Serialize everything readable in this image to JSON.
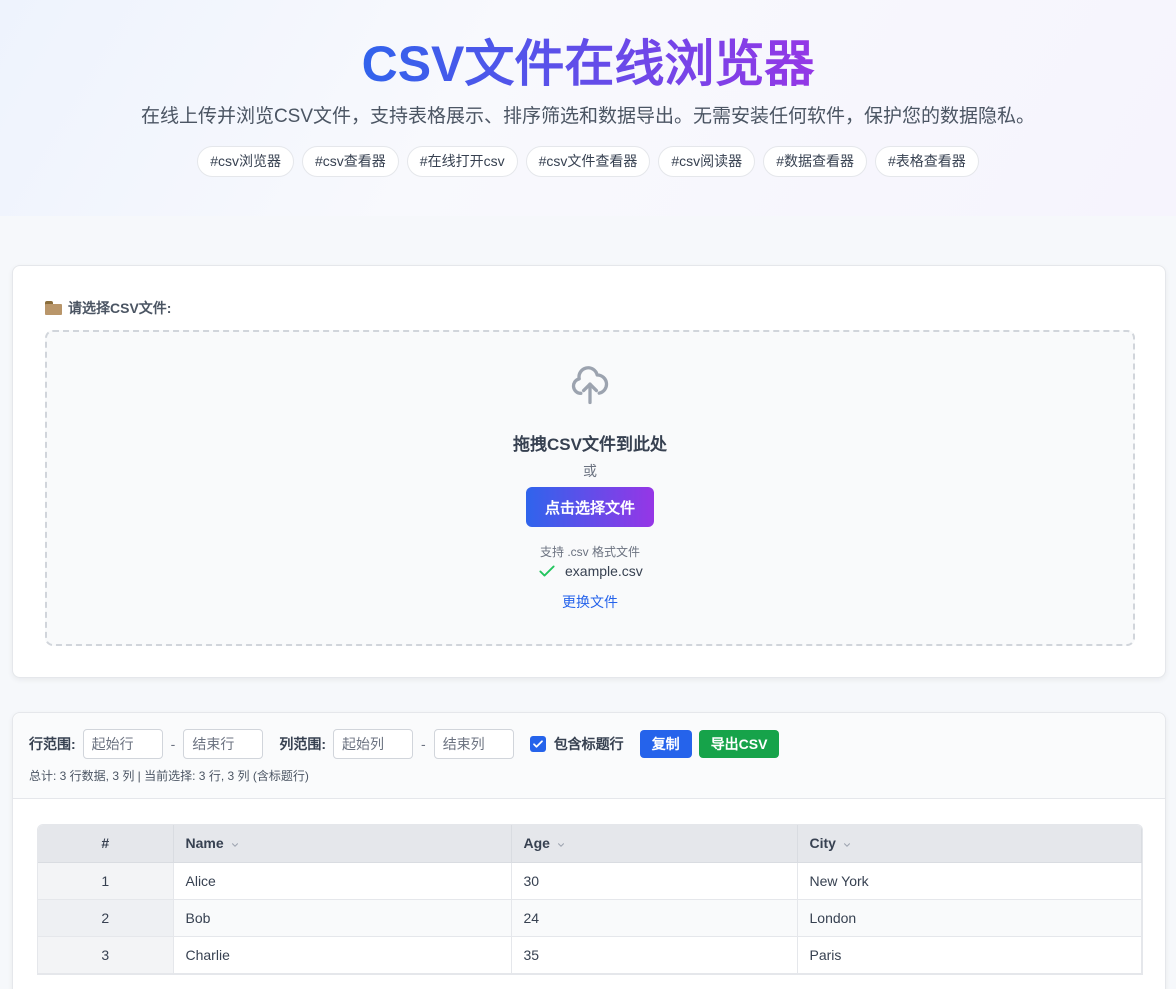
{
  "hero": {
    "title": "CSV文件在线浏览器",
    "subtitle": "在线上传并浏览CSV文件，支持表格展示、排序筛选和数据导出。无需安装任何软件，保护您的数据隐私。",
    "tags": [
      "#csv浏览器",
      "#csv查看器",
      "#在线打开csv",
      "#csv文件查看器",
      "#csv阅读器",
      "#数据查看器",
      "#表格查看器"
    ]
  },
  "upload": {
    "label": "请选择CSV文件:",
    "drop_title": "拖拽CSV文件到此处",
    "or": "或",
    "choose_button": "点击选择文件",
    "support": "支持 .csv 格式文件",
    "file_name": "example.csv",
    "change_link": "更换文件"
  },
  "toolbar": {
    "row_range_label": "行范围:",
    "row_start_placeholder": "起始行",
    "row_end_placeholder": "结束行",
    "col_range_label": "列范围:",
    "col_start_placeholder": "起始列",
    "col_end_placeholder": "结束列",
    "dash": "-",
    "include_header_label": "包含标题行",
    "include_header_checked": true,
    "copy_button": "复制",
    "export_button": "导出CSV",
    "summary": "总计: 3 行数据, 3 列 | 当前选择: 3 行, 3 列 (含标题行)"
  },
  "table": {
    "columns": [
      "#",
      "Name",
      "Age",
      "City"
    ],
    "rows": [
      [
        "1",
        "Alice",
        "30",
        "New York"
      ],
      [
        "2",
        "Bob",
        "24",
        "London"
      ],
      [
        "3",
        "Charlie",
        "35",
        "Paris"
      ]
    ]
  },
  "colors": {
    "accent_blue": "#2563eb",
    "accent_purple": "#9636e6",
    "export_green": "#16a34a",
    "check_green": "#22c55e"
  }
}
